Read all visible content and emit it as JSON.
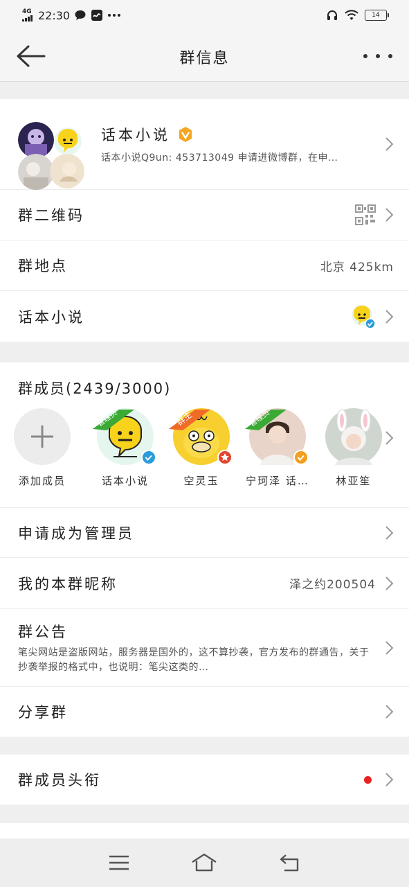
{
  "status_bar": {
    "network": "4G",
    "time": "22:30",
    "battery": "14"
  },
  "header": {
    "title": "群信息"
  },
  "group": {
    "name": "话本小说",
    "description": "话本小说Q9un: 453713049 申请进微博群，在申…"
  },
  "rows": {
    "qr_code": "群二维码",
    "location_label": "群地点",
    "location_value": "北京 425km",
    "app_label": "话本小说"
  },
  "members": {
    "header": "群成员(2439/3000)",
    "add_label": "添加成员",
    "list": [
      {
        "name": "话本小说",
        "ribbon": "管理员",
        "ribbon_color": "#3aaa35",
        "badge_color": "#2a9bdc"
      },
      {
        "name": "空灵玉",
        "ribbon": "群主",
        "ribbon_color": "#f06a28",
        "badge_color": "#e2452f"
      },
      {
        "name": "宁珂泽 话…",
        "ribbon": "管理员",
        "ribbon_color": "#3aaa35",
        "badge_color": "#f0a01e"
      },
      {
        "name": "林亚笙",
        "ribbon": "",
        "ribbon_color": "",
        "badge_color": ""
      }
    ]
  },
  "settings": {
    "apply_admin": "申请成为管理员",
    "nickname_label": "我的本群昵称",
    "nickname_value": "泽之约200504",
    "notice_label": "群公告",
    "notice_text": "笔尖网站是盗版网站，服务器是国外的，这不算抄袭，官方发布的群通告，关于抄袭举报的格式中，也说明：笔尖这类的…",
    "share": "分享群",
    "member_title": "群成员头衔"
  },
  "colors": {
    "red_dot": "#e8231f",
    "chevron": "#9a9a9a"
  }
}
